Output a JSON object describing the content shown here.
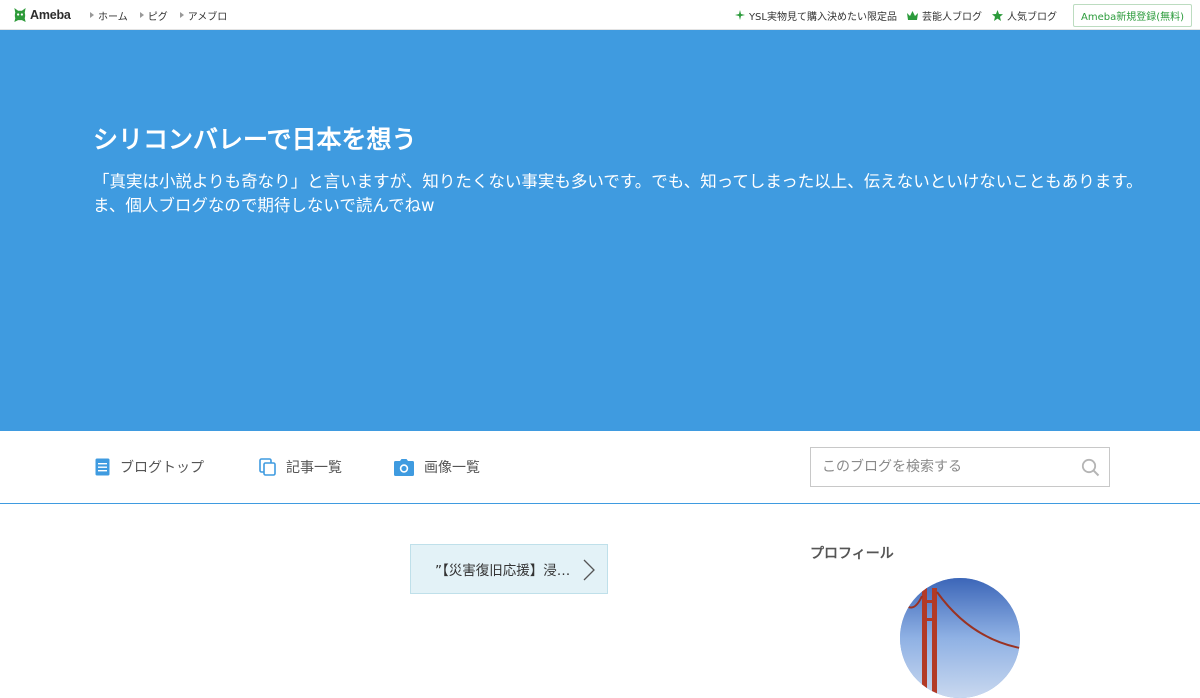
{
  "header": {
    "logo_text": "Ameba",
    "nav": [
      {
        "label": "ホーム"
      },
      {
        "label": "ピグ"
      },
      {
        "label": "アメブロ"
      }
    ],
    "links": [
      {
        "label": "YSL実物見て購入決めたい限定品",
        "icon": "sparkle-icon"
      },
      {
        "label": "芸能人ブログ",
        "icon": "crown-icon"
      },
      {
        "label": "人気ブログ",
        "icon": "star-icon"
      }
    ],
    "signup_label": "Ameba新規登録(無料)"
  },
  "hero": {
    "title": "シリコンバレーで日本を想う",
    "description": "「真実は小説よりも奇なり」と言いますが、知りたくない事実も多いです。でも、知ってしまった以上、伝えないといけないこともあります。ま、個人ブログなので期待しないで読んでねw"
  },
  "tabs": [
    {
      "label": "ブログトップ",
      "icon": "document-icon"
    },
    {
      "label": "記事一覧",
      "icon": "copy-icon"
    },
    {
      "label": "画像一覧",
      "icon": "camera-icon"
    }
  ],
  "search": {
    "placeholder": "このブログを検索する",
    "icon": "search-icon"
  },
  "content": {
    "pager_label": "”【災害復旧応援】浸…",
    "profile_heading": "プロフィール"
  },
  "colors": {
    "hero_bg": "#3f9be0",
    "brand_green": "#2b9b3b",
    "accent_blue": "#3f9be0"
  }
}
